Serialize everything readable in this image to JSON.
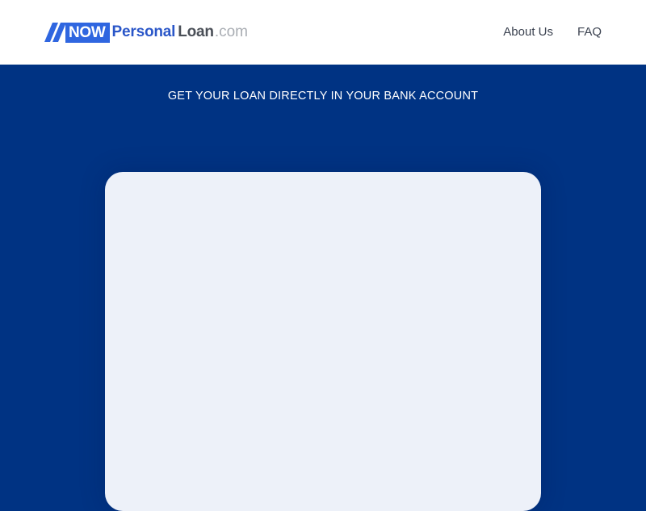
{
  "header": {
    "logo": {
      "now": "NOW",
      "personal": "Personal",
      "loan": "Loan",
      "dotcom": ".com",
      "icon": "stripes-icon"
    },
    "nav": {
      "about": "About Us",
      "faq": "FAQ"
    }
  },
  "hero": {
    "title": "GET YOUR LOAN DIRECTLY IN YOUR BANK ACCOUNT"
  },
  "colors": {
    "background": "#003383",
    "brand_blue": "#2f66e0",
    "card": "#edf1f9"
  }
}
